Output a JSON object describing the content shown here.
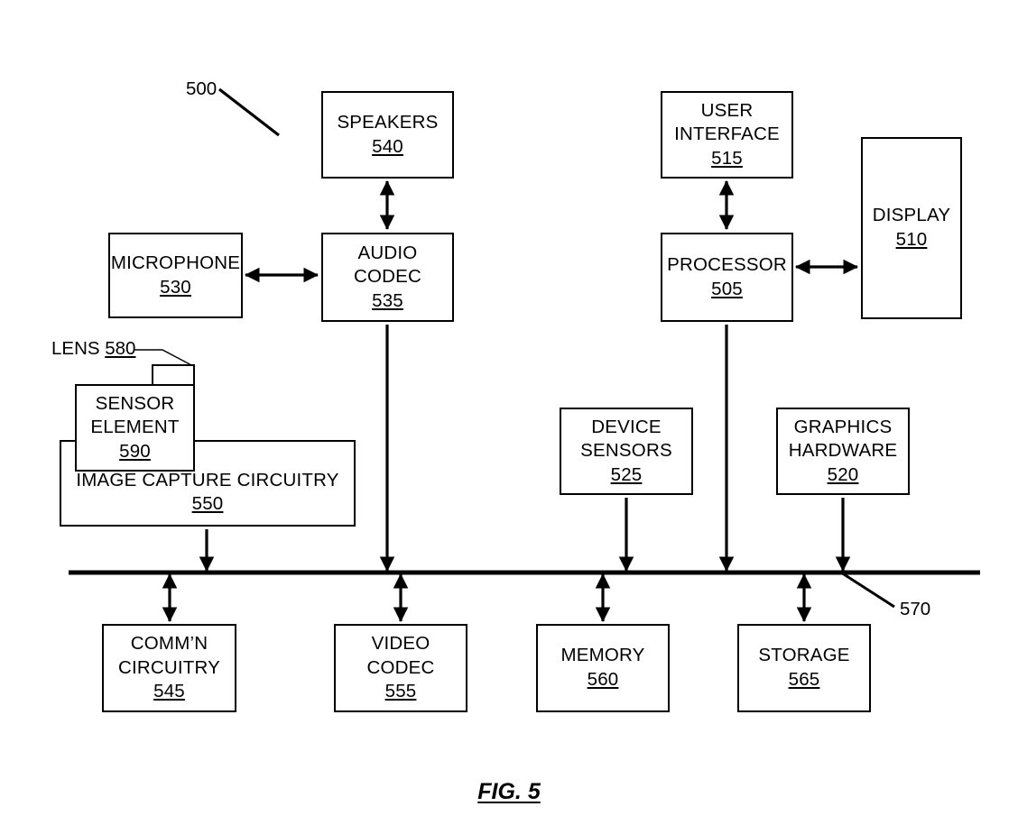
{
  "figure": {
    "caption": "FIG. 5",
    "system_ref": "500",
    "bus_ref": "570"
  },
  "lens_label": {
    "text": "LENS ",
    "number": "580"
  },
  "blocks": {
    "speakers": {
      "line1": "SPEAKERS",
      "line2": "",
      "number": "540"
    },
    "microphone": {
      "line1": "MICROPHONE",
      "line2": "",
      "number": "530"
    },
    "audio_codec": {
      "line1": "AUDIO",
      "line2": "CODEC",
      "number": "535"
    },
    "user_interface": {
      "line1": "USER",
      "line2": "INTERFACE",
      "number": "515"
    },
    "processor": {
      "line1": "PROCESSOR",
      "line2": "",
      "number": "505"
    },
    "display": {
      "line1": "DISPLAY",
      "line2": "",
      "number": "510"
    },
    "sensor_element": {
      "line1": "SENSOR",
      "line2": "ELEMENT",
      "number": "590"
    },
    "image_capture": {
      "line1": "IMAGE CAPTURE CIRCUITRY",
      "line2": "",
      "number": "550"
    },
    "device_sensors": {
      "line1": "DEVICE",
      "line2": "SENSORS",
      "number": "525"
    },
    "graphics_hw": {
      "line1": "GRAPHICS",
      "line2": "HARDWARE",
      "number": "520"
    },
    "comm_circuitry": {
      "line1": "COMM’N",
      "line2": "CIRCUITRY",
      "number": "545"
    },
    "video_codec": {
      "line1": "VIDEO",
      "line2": "CODEC",
      "number": "555"
    },
    "memory": {
      "line1": "MEMORY",
      "line2": "",
      "number": "560"
    },
    "storage": {
      "line1": "STORAGE",
      "line2": "",
      "number": "565"
    }
  },
  "colors": {
    "stroke": "#000000",
    "background": "#ffffff"
  }
}
